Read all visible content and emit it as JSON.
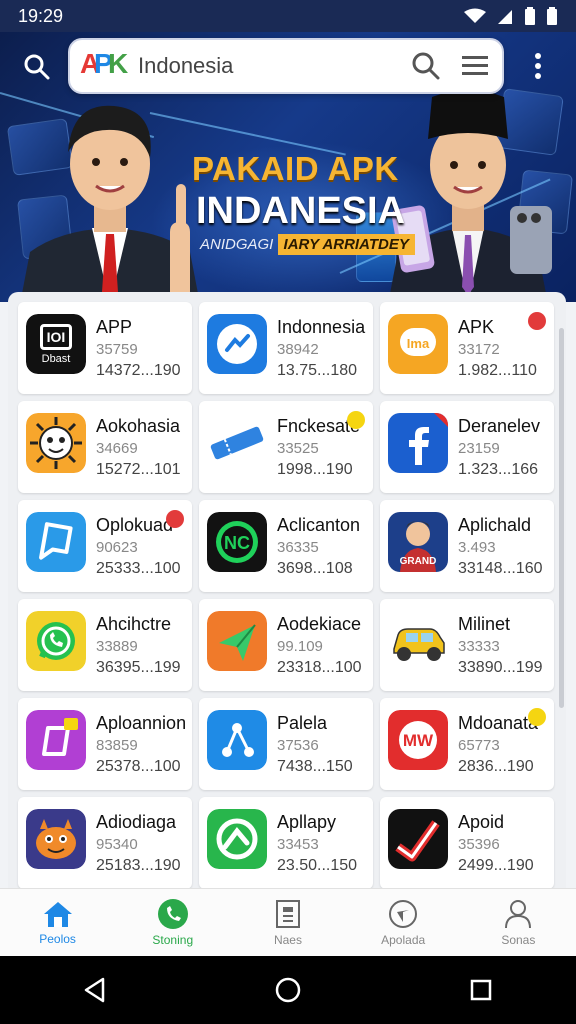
{
  "status_bar": {
    "time": "19:29"
  },
  "search": {
    "text": "Indonesia"
  },
  "banner": {
    "title1": "PAKAID APK",
    "title2": "INDANESIA",
    "subtitle_a": "ANIDGAGI",
    "subtitle_b": "IARY ARRIATDEY"
  },
  "apps": [
    {
      "name": "APP",
      "count": "35759",
      "size": "14372...190",
      "icon": "dbast-icon",
      "icon_text": "Dbast",
      "color": "#111111",
      "badge": ""
    },
    {
      "name": "Indonnesia",
      "count": "38942",
      "size": "13.75...180",
      "icon": "chart-icon",
      "color": "#1e7be0",
      "badge": ""
    },
    {
      "name": "APK",
      "count": "33172",
      "size": "1.982...110",
      "icon": "ima-icon",
      "icon_text": "Ima",
      "color": "#f5a623",
      "badge": "red"
    },
    {
      "name": "Aokohasia",
      "count": "34669",
      "size": "15272...101",
      "icon": "sun-face-icon",
      "color": "#f7a62c",
      "badge": ""
    },
    {
      "name": "Fnckesate",
      "count": "33525",
      "size": "1998...190",
      "icon": "ticket-icon",
      "color": "#2f83e0",
      "badge": "yellow"
    },
    {
      "name": "Deranelev",
      "count": "23159",
      "size": "1.323...166",
      "icon": "facebook-icon",
      "color": "#1b5fcf",
      "badge": ""
    },
    {
      "name": "Oplokuad",
      "count": "90623",
      "size": "25333...100",
      "icon": "chat-bubble-icon",
      "color": "#2a9ae8",
      "badge": "red"
    },
    {
      "name": "Aclicanton",
      "count": "36335",
      "size": "3698...108",
      "icon": "nc-icon",
      "icon_text": "NC",
      "color": "#121212",
      "badge": ""
    },
    {
      "name": "Aplichald",
      "count": "3.493",
      "size": "33148...160",
      "icon": "game-character-icon",
      "icon_text": "GRAND",
      "color": "#1d3f8a",
      "badge": ""
    },
    {
      "name": "Ahcihctre",
      "count": "33889",
      "size": "36395...199",
      "icon": "whatsapp-icon",
      "color": "#f1d12a",
      "badge": ""
    },
    {
      "name": "Aodekiace",
      "count": "99.109",
      "size": "23318...100",
      "icon": "send-arrow-icon",
      "color": "#f07a2a",
      "badge": ""
    },
    {
      "name": "Milinet",
      "count": "33333",
      "size": "33890...199",
      "icon": "car-icon",
      "color": "#ffffff",
      "badge": ""
    },
    {
      "name": "Aploannion",
      "count": "83859",
      "size": "25378...100",
      "icon": "purple-card-icon",
      "color": "#b13fd3",
      "badge": ""
    },
    {
      "name": "Palela",
      "count": "37536",
      "size": "7438...150",
      "icon": "share-icon",
      "color": "#1f8be6",
      "badge": ""
    },
    {
      "name": "Mdoanata",
      "count": "65773",
      "size": "2836...190",
      "icon": "mw-icon",
      "icon_text": "MW",
      "color": "#e22d2d",
      "badge": "yellow"
    },
    {
      "name": "Adiodiaga",
      "count": "95340",
      "size": "25183...190",
      "icon": "monster-icon",
      "color": "#3a3a8a",
      "badge": ""
    },
    {
      "name": "Apllapy",
      "count": "33453",
      "size": "23.50...150",
      "icon": "green-circle-icon",
      "color": "#28b64c",
      "badge": ""
    },
    {
      "name": "Apoid",
      "count": "35396",
      "size": "2499...190",
      "icon": "check-chart-icon",
      "color": "#111111",
      "badge": ""
    }
  ],
  "nav": [
    {
      "label": "Peolos",
      "icon": "home-icon"
    },
    {
      "label": "Stoning",
      "icon": "phone-icon"
    },
    {
      "label": "Naes",
      "icon": "document-icon"
    },
    {
      "label": "Apolada",
      "icon": "compass-icon"
    },
    {
      "label": "Sonas",
      "icon": "person-icon"
    }
  ]
}
